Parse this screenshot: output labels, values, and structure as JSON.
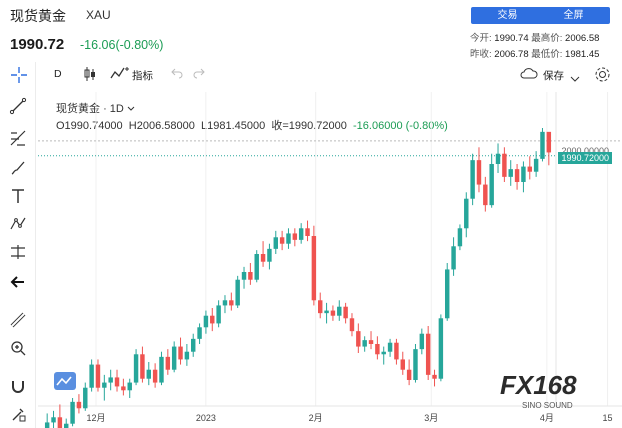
{
  "header": {
    "title": "现货黄金",
    "symbol": "XAU",
    "price": "1990.72",
    "change": "-16.06(-0.80%)",
    "trade_button": "交易",
    "fullscreen_button": "全屏",
    "quotes": {
      "open_label": "今开:",
      "open_value": "1990.74",
      "high_label": "最高价:",
      "high_value": "2006.58",
      "prev_close_label": "昨收:",
      "prev_close_value": "2006.78",
      "low_label": "最低价:",
      "low_value": "1981.45"
    }
  },
  "chart_toolbar": {
    "interval": "D",
    "indicators_label": "指标",
    "save_label": "保存"
  },
  "legend": {
    "name": "现货黄金",
    "period": "1D",
    "open": "O1990.74000",
    "high": "H2006.58000",
    "low": "L1981.45000",
    "close": "收=1990.72000",
    "change": "-16.06000 (-0.80%)"
  },
  "price_axis": {
    "level_label": "2000.00000",
    "last_price_tag": "1990.72000"
  },
  "watermark": {
    "brand": "FX168",
    "sub": "SINO SOUND"
  },
  "chart_data": {
    "type": "candlestick",
    "x_ticks": [
      "12月",
      "2023",
      "2月",
      "3月",
      "4月",
      "15"
    ],
    "ylim": [
      1800,
      2010
    ],
    "colors": {
      "up": "#26a69a",
      "down": "#ef5350"
    },
    "candles": [
      {
        "o": 1776,
        "h": 1788,
        "l": 1770,
        "c": 1781
      },
      {
        "o": 1781,
        "h": 1790,
        "l": 1776,
        "c": 1785
      },
      {
        "o": 1785,
        "h": 1795,
        "l": 1768,
        "c": 1772
      },
      {
        "o": 1772,
        "h": 1784,
        "l": 1765,
        "c": 1780
      },
      {
        "o": 1780,
        "h": 1800,
        "l": 1778,
        "c": 1797
      },
      {
        "o": 1797,
        "h": 1803,
        "l": 1788,
        "c": 1792
      },
      {
        "o": 1792,
        "h": 1812,
        "l": 1790,
        "c": 1808
      },
      {
        "o": 1808,
        "h": 1830,
        "l": 1805,
        "c": 1826
      },
      {
        "o": 1826,
        "h": 1830,
        "l": 1805,
        "c": 1808
      },
      {
        "o": 1808,
        "h": 1818,
        "l": 1798,
        "c": 1812
      },
      {
        "o": 1812,
        "h": 1822,
        "l": 1806,
        "c": 1816
      },
      {
        "o": 1816,
        "h": 1822,
        "l": 1805,
        "c": 1809
      },
      {
        "o": 1809,
        "h": 1815,
        "l": 1802,
        "c": 1806
      },
      {
        "o": 1806,
        "h": 1815,
        "l": 1800,
        "c": 1812
      },
      {
        "o": 1812,
        "h": 1838,
        "l": 1810,
        "c": 1834
      },
      {
        "o": 1834,
        "h": 1840,
        "l": 1812,
        "c": 1815
      },
      {
        "o": 1815,
        "h": 1828,
        "l": 1810,
        "c": 1822
      },
      {
        "o": 1822,
        "h": 1827,
        "l": 1808,
        "c": 1812
      },
      {
        "o": 1812,
        "h": 1836,
        "l": 1810,
        "c": 1832
      },
      {
        "o": 1832,
        "h": 1838,
        "l": 1818,
        "c": 1822
      },
      {
        "o": 1822,
        "h": 1844,
        "l": 1820,
        "c": 1840
      },
      {
        "o": 1840,
        "h": 1847,
        "l": 1826,
        "c": 1830
      },
      {
        "o": 1830,
        "h": 1842,
        "l": 1825,
        "c": 1836
      },
      {
        "o": 1836,
        "h": 1850,
        "l": 1832,
        "c": 1846
      },
      {
        "o": 1846,
        "h": 1858,
        "l": 1842,
        "c": 1855
      },
      {
        "o": 1855,
        "h": 1868,
        "l": 1850,
        "c": 1864
      },
      {
        "o": 1864,
        "h": 1870,
        "l": 1852,
        "c": 1858
      },
      {
        "o": 1858,
        "h": 1876,
        "l": 1855,
        "c": 1872
      },
      {
        "o": 1872,
        "h": 1880,
        "l": 1866,
        "c": 1876
      },
      {
        "o": 1876,
        "h": 1882,
        "l": 1868,
        "c": 1872
      },
      {
        "o": 1872,
        "h": 1895,
        "l": 1870,
        "c": 1892
      },
      {
        "o": 1892,
        "h": 1902,
        "l": 1885,
        "c": 1898
      },
      {
        "o": 1898,
        "h": 1905,
        "l": 1888,
        "c": 1892
      },
      {
        "o": 1892,
        "h": 1915,
        "l": 1890,
        "c": 1912
      },
      {
        "o": 1912,
        "h": 1922,
        "l": 1902,
        "c": 1906
      },
      {
        "o": 1906,
        "h": 1920,
        "l": 1900,
        "c": 1916
      },
      {
        "o": 1916,
        "h": 1930,
        "l": 1912,
        "c": 1925
      },
      {
        "o": 1925,
        "h": 1930,
        "l": 1915,
        "c": 1920
      },
      {
        "o": 1920,
        "h": 1932,
        "l": 1916,
        "c": 1928
      },
      {
        "o": 1928,
        "h": 1932,
        "l": 1918,
        "c": 1923
      },
      {
        "o": 1923,
        "h": 1936,
        "l": 1920,
        "c": 1932
      },
      {
        "o": 1932,
        "h": 1938,
        "l": 1922,
        "c": 1926
      },
      {
        "o": 1926,
        "h": 1934,
        "l": 1872,
        "c": 1876
      },
      {
        "o": 1876,
        "h": 1882,
        "l": 1862,
        "c": 1866
      },
      {
        "o": 1866,
        "h": 1874,
        "l": 1858,
        "c": 1868
      },
      {
        "o": 1868,
        "h": 1872,
        "l": 1860,
        "c": 1864
      },
      {
        "o": 1864,
        "h": 1876,
        "l": 1860,
        "c": 1871
      },
      {
        "o": 1871,
        "h": 1874,
        "l": 1858,
        "c": 1862
      },
      {
        "o": 1862,
        "h": 1866,
        "l": 1848,
        "c": 1852
      },
      {
        "o": 1852,
        "h": 1858,
        "l": 1835,
        "c": 1840
      },
      {
        "o": 1840,
        "h": 1848,
        "l": 1836,
        "c": 1845
      },
      {
        "o": 1845,
        "h": 1852,
        "l": 1838,
        "c": 1842
      },
      {
        "o": 1842,
        "h": 1848,
        "l": 1830,
        "c": 1834
      },
      {
        "o": 1834,
        "h": 1840,
        "l": 1826,
        "c": 1836
      },
      {
        "o": 1836,
        "h": 1846,
        "l": 1832,
        "c": 1843
      },
      {
        "o": 1843,
        "h": 1846,
        "l": 1826,
        "c": 1830
      },
      {
        "o": 1830,
        "h": 1836,
        "l": 1818,
        "c": 1822
      },
      {
        "o": 1822,
        "h": 1830,
        "l": 1810,
        "c": 1814
      },
      {
        "o": 1814,
        "h": 1842,
        "l": 1812,
        "c": 1838
      },
      {
        "o": 1838,
        "h": 1854,
        "l": 1834,
        "c": 1850
      },
      {
        "o": 1850,
        "h": 1856,
        "l": 1814,
        "c": 1818
      },
      {
        "o": 1818,
        "h": 1822,
        "l": 1809,
        "c": 1815
      },
      {
        "o": 1815,
        "h": 1865,
        "l": 1813,
        "c": 1862
      },
      {
        "o": 1862,
        "h": 1905,
        "l": 1860,
        "c": 1900
      },
      {
        "o": 1900,
        "h": 1925,
        "l": 1895,
        "c": 1918
      },
      {
        "o": 1918,
        "h": 1935,
        "l": 1915,
        "c": 1932
      },
      {
        "o": 1932,
        "h": 1960,
        "l": 1925,
        "c": 1955
      },
      {
        "o": 1955,
        "h": 1990,
        "l": 1950,
        "c": 1985
      },
      {
        "o": 1985,
        "h": 1995,
        "l": 1960,
        "c": 1966
      },
      {
        "o": 1966,
        "h": 1972,
        "l": 1945,
        "c": 1950
      },
      {
        "o": 1950,
        "h": 1990,
        "l": 1948,
        "c": 1982
      },
      {
        "o": 1982,
        "h": 1998,
        "l": 1975,
        "c": 1990
      },
      {
        "o": 1990,
        "h": 1995,
        "l": 1968,
        "c": 1972
      },
      {
        "o": 1972,
        "h": 1985,
        "l": 1965,
        "c": 1978
      },
      {
        "o": 1978,
        "h": 1982,
        "l": 1962,
        "c": 1968
      },
      {
        "o": 1968,
        "h": 1984,
        "l": 1960,
        "c": 1980
      },
      {
        "o": 1980,
        "h": 1988,
        "l": 1970,
        "c": 1976
      },
      {
        "o": 1976,
        "h": 1992,
        "l": 1972,
        "c": 1986
      },
      {
        "o": 1986,
        "h": 2010,
        "l": 1984,
        "c": 2007
      },
      {
        "o": 2007,
        "h": 2006,
        "l": 1981,
        "c": 1991
      }
    ]
  }
}
